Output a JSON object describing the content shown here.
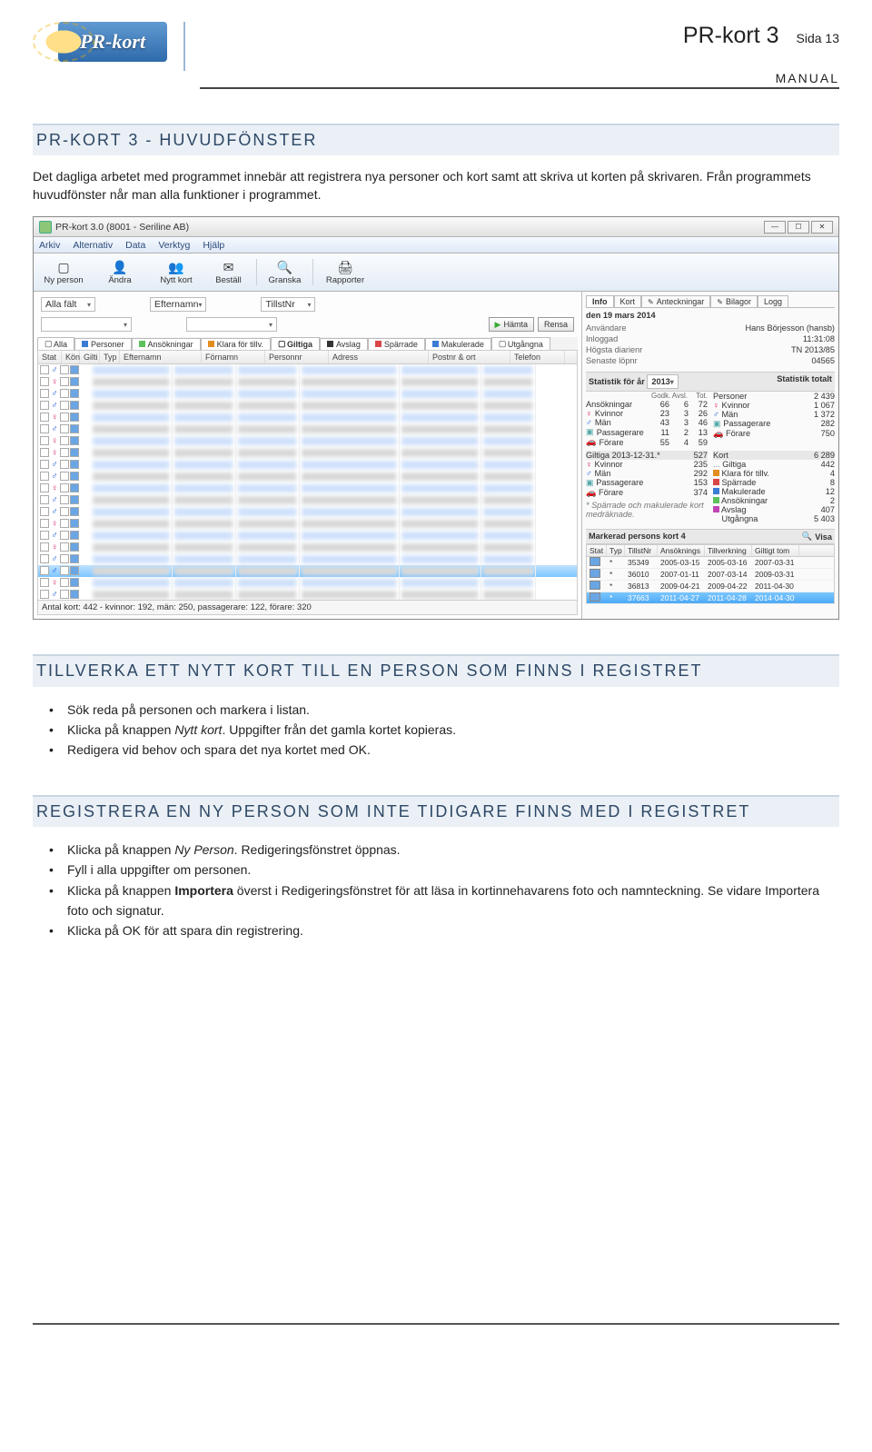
{
  "header": {
    "logo_text": "PR-kort",
    "title_bold": "PR-kort 3",
    "sida": "Sida 13",
    "manual": "MANUAL"
  },
  "section1": {
    "heading": "PR-KORT 3 - HUVUDFÖNSTER",
    "para": "Det dagliga arbetet med programmet innebär att registrera nya personer och kort samt att skriva ut korten på skrivaren. Från programmets huvudfönster når man alla funktioner i programmet."
  },
  "window": {
    "title": "PR-kort 3.0 (8001 - Seriline AB)",
    "menu": [
      "Arkiv",
      "Alternativ",
      "Data",
      "Verktyg",
      "Hjälp"
    ],
    "toolbar": [
      {
        "glyph": "▢",
        "label": "Ny person"
      },
      {
        "glyph": "👤",
        "label": "Ändra"
      },
      {
        "glyph": "👥",
        "label": "Nytt kort"
      },
      {
        "glyph": "✉",
        "label": "Beställ"
      },
      {
        "glyph": "🔍",
        "label": "Granska"
      },
      {
        "glyph": "🖨",
        "label": "Rapporter"
      }
    ],
    "filters": {
      "alla": "Alla fält",
      "efternamn": "Efternamn",
      "tillst": "TillstNr",
      "hamta": "Hämta",
      "rensa": "Rensa"
    },
    "tabs": [
      {
        "sq": "none",
        "label": "Alla"
      },
      {
        "sq": "blue",
        "label": "Personer"
      },
      {
        "sq": "green",
        "label": "Ansökningar"
      },
      {
        "sq": "orange",
        "label": "Klara för tillv."
      },
      {
        "sq": "none",
        "label": "Giltiga",
        "active": true
      },
      {
        "sq": "black",
        "label": "Avslag"
      },
      {
        "sq": "red",
        "label": "Spärrade"
      },
      {
        "sq": "blue",
        "label": "Makulerade"
      },
      {
        "sq": "none",
        "label": "Utgångna"
      }
    ],
    "grid_cols": [
      "Stat",
      "Kön",
      "Gilti",
      "Typ",
      "Efternamn",
      "Förnamn",
      "Personnr",
      "Adress",
      "Postnr & ort",
      "Telefon"
    ],
    "footer": "Antal kort: 442 - kvinnor: 192, män: 250, passagerare: 122, förare: 320",
    "info": {
      "date": "den 19 mars 2014",
      "tabs": [
        "Info",
        "Kort",
        "Anteckningar",
        "Bilagor",
        "Logg"
      ],
      "kv": [
        {
          "k": "Användare",
          "v": "Hans Börjesson (hansb)"
        },
        {
          "k": "Inloggad",
          "v": "11:31:08"
        },
        {
          "k": "Högsta diarienr",
          "v": "TN 2013/85"
        },
        {
          "k": "Senaste löpnr",
          "v": "04565"
        }
      ],
      "year_label": "Statistik för år",
      "year": "2013",
      "total_label": "Statistik totalt",
      "year_heads": [
        "Godk.",
        "Avsl.",
        "Tot."
      ],
      "year_rows": [
        {
          "lab": "Ansökningar",
          "g": "66",
          "a": "6",
          "t": "72"
        },
        {
          "lab": "Kvinnor",
          "sym": "♀",
          "c": "#d82573",
          "g": "23",
          "a": "3",
          "t": "26"
        },
        {
          "lab": "Män",
          "sym": "♂",
          "c": "#1a5cd8",
          "g": "43",
          "a": "3",
          "t": "46"
        },
        {
          "lab": "Passagerare",
          "sym": "▣",
          "c": "#5aa",
          "g": "11",
          "a": "2",
          "t": "13"
        },
        {
          "lab": "Förare",
          "sym": "🚗",
          "c": "#5a7",
          "g": "55",
          "a": "4",
          "t": "59"
        }
      ],
      "totals": [
        {
          "lab": "Personer",
          "v": "2 439"
        },
        {
          "lab": "Kvinnor",
          "sym": "♀",
          "c": "#d82573",
          "v": "1 067"
        },
        {
          "lab": "Män",
          "sym": "♂",
          "c": "#1a5cd8",
          "v": "1 372"
        },
        {
          "lab": "Passagerare",
          "sym": "▣",
          "c": "#5aa",
          "v": "282"
        },
        {
          "lab": "Förare",
          "sym": "🚗",
          "c": "#5a7",
          "v": "750"
        }
      ],
      "giltiga_date": "Giltiga 2013-12-31.*",
      "giltiga_n": "527",
      "gilt_rows": [
        {
          "lab": "Kvinnor",
          "sym": "♀",
          "c": "#d82573",
          "v": "235"
        },
        {
          "lab": "Män",
          "sym": "♂",
          "c": "#1a5cd8",
          "v": "292"
        },
        {
          "lab": "Passagerare",
          "sym": "▣",
          "c": "#5aa",
          "v": "153"
        },
        {
          "lab": "Förare",
          "sym": "🚗",
          "c": "#5a7",
          "v": "374"
        }
      ],
      "kort_lab": "Kort",
      "kort_n": "6 289",
      "kort_rows": [
        {
          "lab": "Giltiga",
          "pre": "...",
          "v": "442"
        },
        {
          "lab": "Klara för tillv.",
          "sq": "orange",
          "v": "4"
        },
        {
          "lab": "Spärrade",
          "sq": "red",
          "v": "8"
        },
        {
          "lab": "Makulerade",
          "sq": "blue",
          "v": "12"
        },
        {
          "lab": "Ansökningar",
          "sq": "green",
          "v": "2"
        },
        {
          "lab": "Avslag",
          "sq": "mag",
          "v": "407"
        },
        {
          "lab": "Utgångna",
          "sq": "none",
          "v": "5 403"
        }
      ],
      "star_note": "* Spärrade och makulerade kort medräknade.",
      "marked_label": "Markerad persons kort",
      "marked_n": "4",
      "visa": "Visa",
      "card_cols": [
        "Stat",
        "Typ",
        "TillstNr",
        "Ansöknings",
        "Tillverkning",
        "Giltigt tom"
      ],
      "cards": [
        {
          "tn": "35349",
          "a": "2005-03-15",
          "t": "2005-03-16",
          "g": "2007-03-31"
        },
        {
          "tn": "36010",
          "a": "2007-01-11",
          "t": "2007-03-14",
          "g": "2009-03-31"
        },
        {
          "tn": "36813",
          "a": "2009-04-21",
          "t": "2009-04-22",
          "g": "2011-04-30"
        },
        {
          "tn": "37663",
          "a": "2011-04-27",
          "t": "2011-04-28",
          "g": "2014-04-30",
          "hl": true
        }
      ]
    }
  },
  "section2": {
    "heading": "TILLVERKA ETT NYTT KORT TILL EN PERSON SOM FINNS I REGISTRET",
    "items": [
      "Sök reda på personen och markera i listan.",
      "Klicka på knappen <em>Nytt kort</em>. Uppgifter från det gamla kortet kopieras.",
      "Redigera vid behov och spara det nya kortet med OK."
    ]
  },
  "section3": {
    "heading": "REGISTRERA EN NY PERSON SOM INTE TIDIGARE FINNS MED I REGISTRET",
    "items": [
      "Klicka på knappen <em>Ny Person</em>. Redigeringsfönstret öppnas.",
      "Fyll i alla uppgifter om personen.",
      "Klicka på knappen <strong>Importera</strong> överst i Redigeringsfönstret för att läsa in kortinnehavarens foto och namnteckning. Se vidare Importera foto och signatur.",
      "Klicka på OK för att spara din registrering."
    ]
  }
}
